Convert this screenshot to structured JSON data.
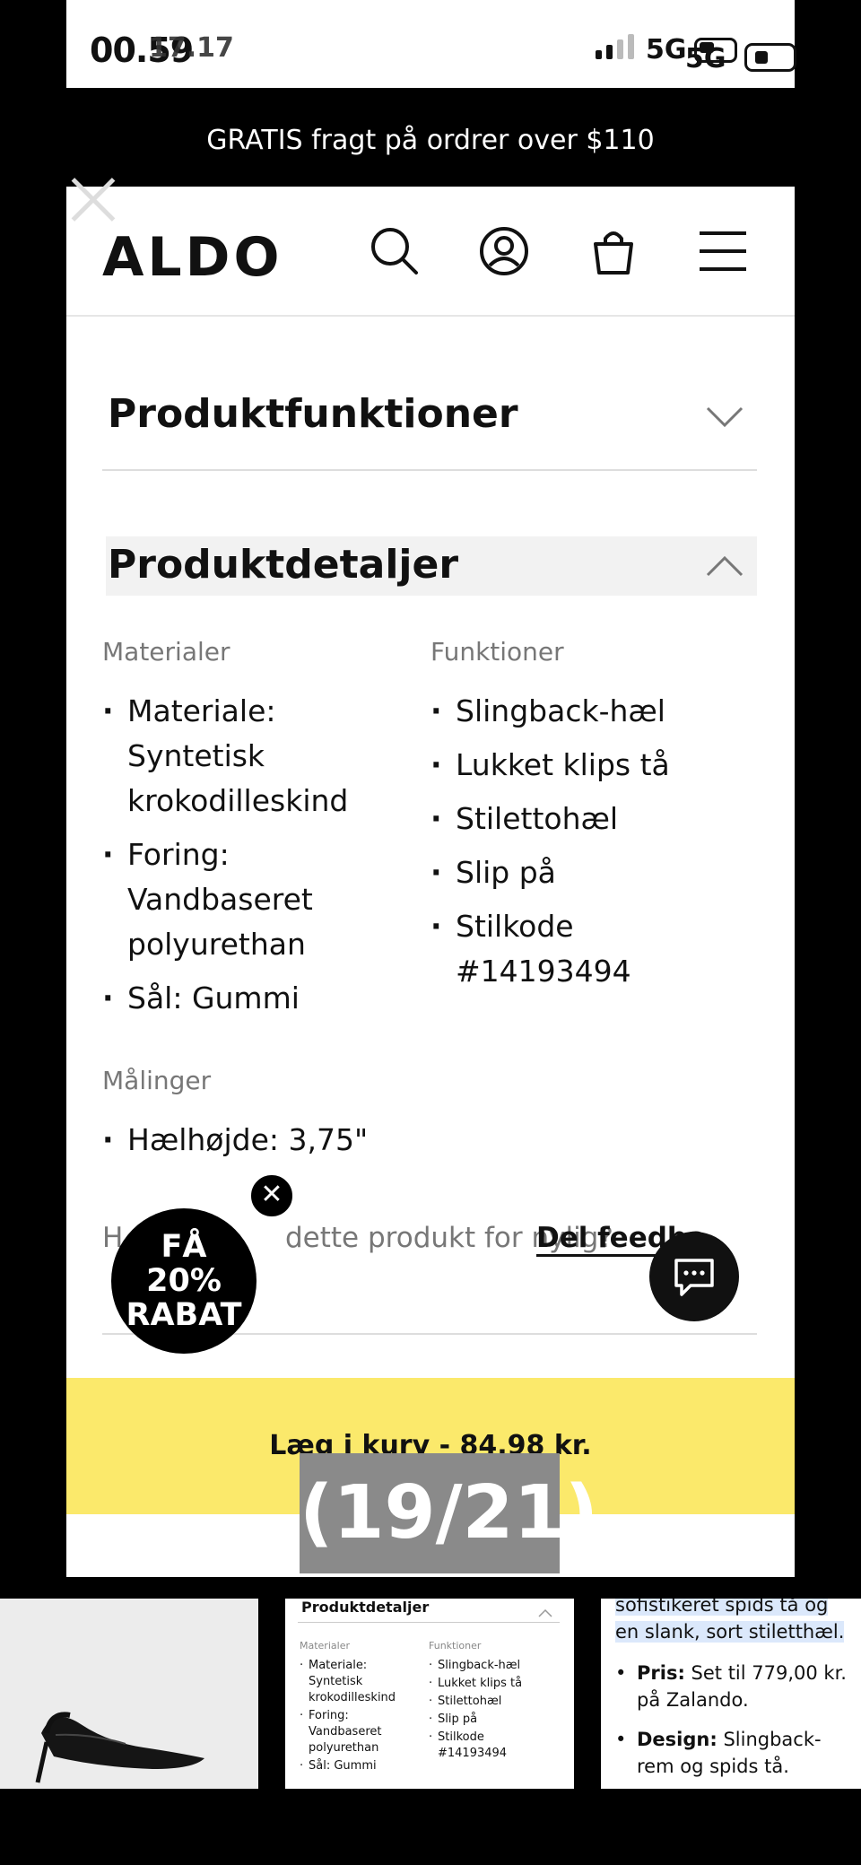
{
  "status_bar": {
    "time_primary": "00.59",
    "time_overlay": "17.17",
    "network_a": "5G",
    "network_b": "5G"
  },
  "promo_banner": {
    "text": "GRATIS fragt på ordrer over $110"
  },
  "header": {
    "logo": "ALDO",
    "icons": [
      "search-icon",
      "account-icon",
      "bag-icon",
      "menu-icon"
    ]
  },
  "accordion": {
    "features_title": "Produktfunktioner",
    "details_title": "Produktdetaljer"
  },
  "details": {
    "materials_heading": "Materialer",
    "materials": [
      "Materiale: Syntetisk krokodilleskind",
      "Foring: Vandbaseret polyurethan",
      "Sål: Gummi"
    ],
    "functions_heading": "Funktioner",
    "functions": [
      "Slingback-hæl",
      "Lukket klips tå",
      "Stilettohæl",
      "Slip på",
      "Stilkode #14193494"
    ],
    "measurements_heading": "Målinger",
    "measurements": [
      "Hælhøjde: 3,75\""
    ]
  },
  "feedback": {
    "question_start": "H",
    "question_end": "dette produkt for nylig?",
    "link": "Del feedba"
  },
  "discount_badge": {
    "line1": "FÅ",
    "line2": "20%",
    "line3": "RABAT"
  },
  "cart_button": {
    "label": "Læg i kurv - 84,98 kr."
  },
  "image_counter": "(19/21)",
  "thumbnails": {
    "details_title": "Produktdetaljer",
    "materials_heading": "Materialer",
    "functions_heading": "Funktioner",
    "materials": [
      "Materiale: Syntetisk krokodilleskind",
      "Foring: Vandbaseret polyurethan",
      "Sål: Gummi"
    ],
    "functions": [
      "Slingback-hæl",
      "Lukket klips tå",
      "Stilettohæl",
      "Slip på",
      "Stilkode #14193494"
    ],
    "text_top": "sofistikeret spids tå og en slank, sort stiletthæl.",
    "price_label": "Pris:",
    "price_text": "Set til 779,00 kr. på Zalando.",
    "design_label": "Design:",
    "design_text": "Slingback-rem og spids tå."
  }
}
